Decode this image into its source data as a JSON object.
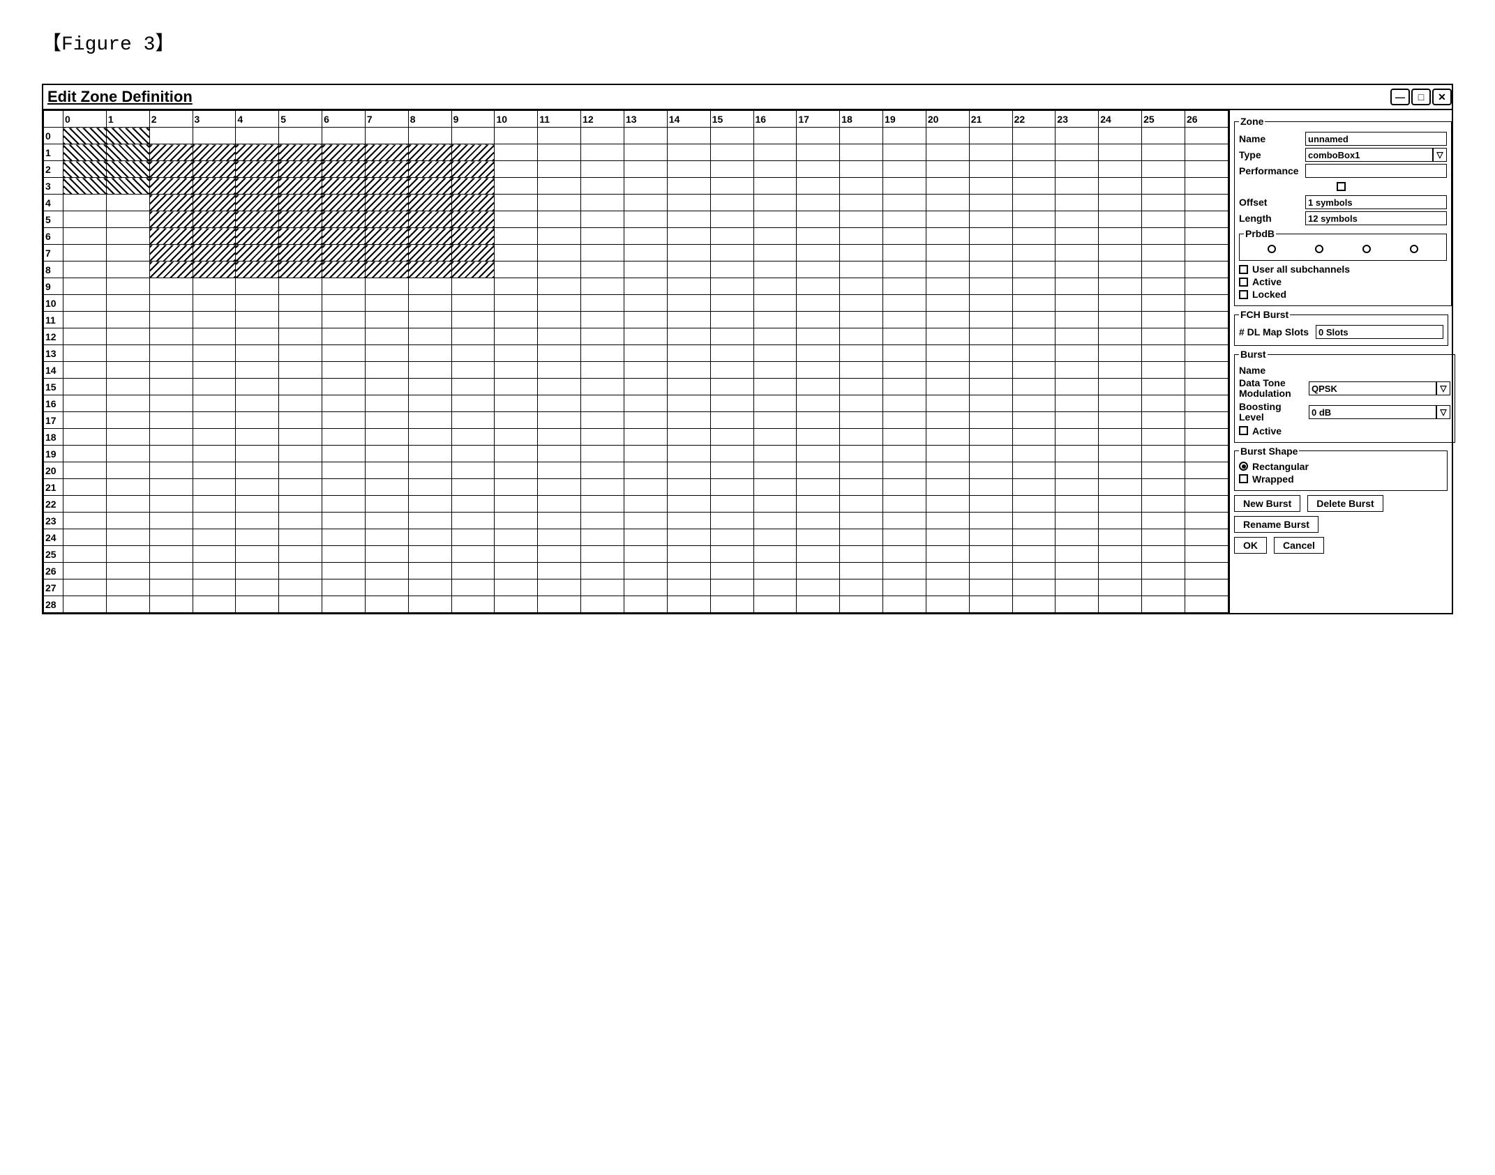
{
  "figure_label": "【Figure 3】",
  "window_title": "Edit Zone Definition",
  "grid": {
    "col_headers": [
      "0",
      "1",
      "2",
      "3",
      "4",
      "5",
      "6",
      "7",
      "8",
      "9",
      "10",
      "11",
      "12",
      "13",
      "14",
      "15",
      "16",
      "17",
      "18",
      "19",
      "20",
      "21",
      "22",
      "23",
      "24",
      "25",
      "26"
    ],
    "row_headers": [
      "0",
      "1",
      "2",
      "3",
      "4",
      "5",
      "6",
      "7",
      "8",
      "9",
      "10",
      "11",
      "12",
      "13",
      "14",
      "15",
      "16",
      "17",
      "18",
      "19",
      "20",
      "21",
      "22",
      "23",
      "24",
      "25",
      "26",
      "27",
      "28"
    ],
    "hatch1_cells": [
      {
        "r": 0,
        "c": 0
      },
      {
        "r": 0,
        "c": 1
      },
      {
        "r": 1,
        "c": 0
      },
      {
        "r": 1,
        "c": 1
      },
      {
        "r": 2,
        "c": 0
      },
      {
        "r": 2,
        "c": 1
      },
      {
        "r": 3,
        "c": 0
      },
      {
        "r": 3,
        "c": 1
      }
    ],
    "hatch2_cells": [
      {
        "r": 1,
        "c": 2
      },
      {
        "r": 1,
        "c": 3
      },
      {
        "r": 1,
        "c": 4
      },
      {
        "r": 1,
        "c": 5
      },
      {
        "r": 1,
        "c": 6
      },
      {
        "r": 1,
        "c": 7
      },
      {
        "r": 1,
        "c": 8
      },
      {
        "r": 1,
        "c": 9
      },
      {
        "r": 2,
        "c": 2
      },
      {
        "r": 2,
        "c": 3
      },
      {
        "r": 2,
        "c": 4
      },
      {
        "r": 2,
        "c": 5
      },
      {
        "r": 2,
        "c": 6
      },
      {
        "r": 2,
        "c": 7
      },
      {
        "r": 2,
        "c": 8
      },
      {
        "r": 2,
        "c": 9
      },
      {
        "r": 3,
        "c": 2
      },
      {
        "r": 3,
        "c": 3
      },
      {
        "r": 3,
        "c": 4
      },
      {
        "r": 3,
        "c": 5
      },
      {
        "r": 3,
        "c": 6
      },
      {
        "r": 3,
        "c": 7
      },
      {
        "r": 3,
        "c": 8
      },
      {
        "r": 3,
        "c": 9
      },
      {
        "r": 4,
        "c": 2
      },
      {
        "r": 4,
        "c": 3
      },
      {
        "r": 4,
        "c": 4
      },
      {
        "r": 4,
        "c": 5
      },
      {
        "r": 4,
        "c": 6
      },
      {
        "r": 4,
        "c": 7
      },
      {
        "r": 4,
        "c": 8
      },
      {
        "r": 4,
        "c": 9
      },
      {
        "r": 5,
        "c": 2
      },
      {
        "r": 5,
        "c": 3
      },
      {
        "r": 5,
        "c": 4
      },
      {
        "r": 5,
        "c": 5
      },
      {
        "r": 5,
        "c": 6
      },
      {
        "r": 5,
        "c": 7
      },
      {
        "r": 5,
        "c": 8
      },
      {
        "r": 5,
        "c": 9
      },
      {
        "r": 6,
        "c": 2
      },
      {
        "r": 6,
        "c": 3
      },
      {
        "r": 6,
        "c": 4
      },
      {
        "r": 6,
        "c": 5
      },
      {
        "r": 6,
        "c": 6
      },
      {
        "r": 6,
        "c": 7
      },
      {
        "r": 6,
        "c": 8
      },
      {
        "r": 6,
        "c": 9
      },
      {
        "r": 7,
        "c": 2
      },
      {
        "r": 7,
        "c": 3
      },
      {
        "r": 7,
        "c": 4
      },
      {
        "r": 7,
        "c": 5
      },
      {
        "r": 7,
        "c": 6
      },
      {
        "r": 7,
        "c": 7
      },
      {
        "r": 7,
        "c": 8
      },
      {
        "r": 7,
        "c": 9
      },
      {
        "r": 8,
        "c": 2
      },
      {
        "r": 8,
        "c": 3
      },
      {
        "r": 8,
        "c": 4
      },
      {
        "r": 8,
        "c": 5
      },
      {
        "r": 8,
        "c": 6
      },
      {
        "r": 8,
        "c": 7
      },
      {
        "r": 8,
        "c": 8
      },
      {
        "r": 8,
        "c": 9
      }
    ]
  },
  "panel": {
    "zone": {
      "legend": "Zone",
      "name_label": "Name",
      "name_value": "unnamed",
      "type_label": "Type",
      "type_value": "comboBox1",
      "performance_label": "Performance",
      "offset_label": "Offset",
      "offset_value": "1 symbols",
      "length_label": "Length",
      "length_value": "12 symbols",
      "prbdb_legend": "PrbdB",
      "use_all_sub": "User all subchannels",
      "active": "Active",
      "locked": "Locked"
    },
    "fch": {
      "legend": "FCH Burst",
      "dlmap_label": "# DL Map Slots",
      "dlmap_value": "0 Slots"
    },
    "burst": {
      "legend": "Burst",
      "name_label": "Name",
      "datatone_label": "Data Tone Modulation",
      "datatone_value": "QPSK",
      "boost_label": "Boosting Level",
      "boost_value": "0 dB",
      "active": "Active"
    },
    "shape": {
      "legend": "Burst Shape",
      "rectangular": "Rectangular",
      "wrapped": "Wrapped"
    },
    "actions": {
      "new_burst": "New Burst",
      "delete_burst": "Delete Burst",
      "rename_burst": "Rename Burst",
      "ok": "OK",
      "cancel": "Cancel"
    }
  }
}
